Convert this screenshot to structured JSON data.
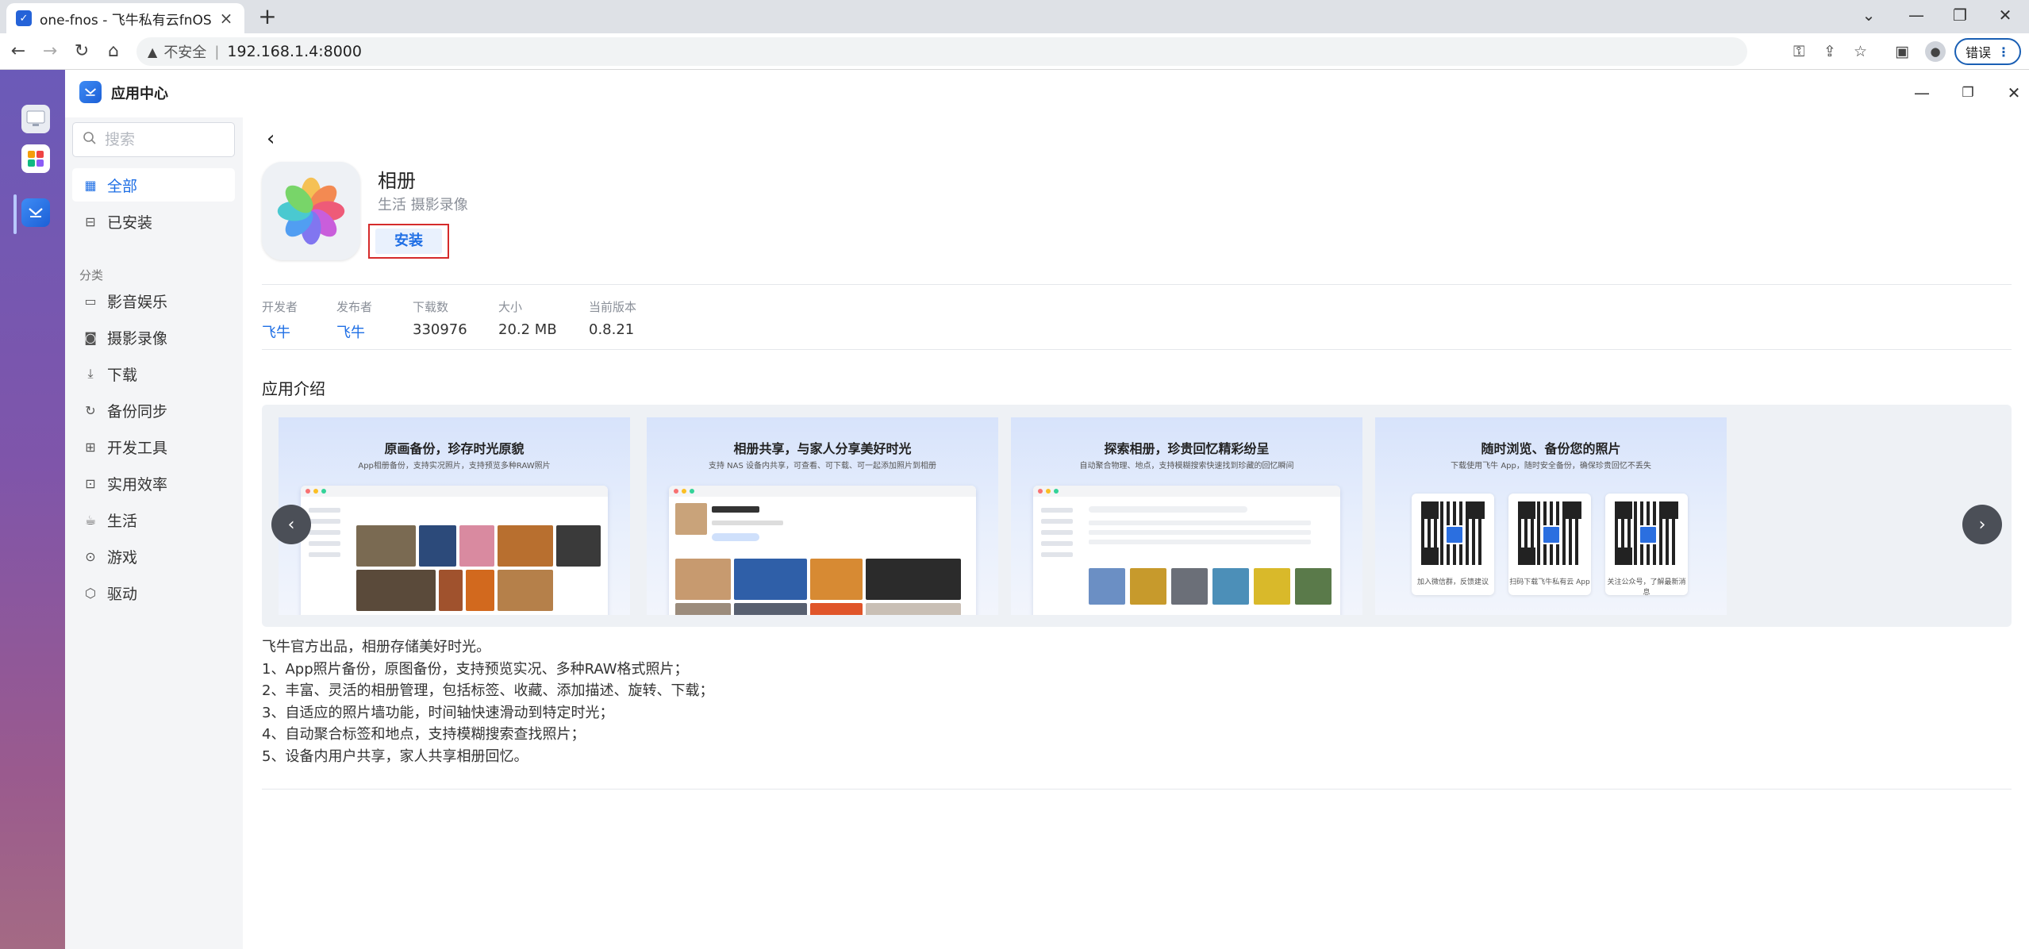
{
  "browser": {
    "tab_title": "one-fnos - 飞牛私有云fnOS",
    "insecure_label": "不安全",
    "url": "192.168.1.4:8000",
    "error_label": "错误"
  },
  "app_window": {
    "title": "应用中心"
  },
  "sidebar": {
    "search_placeholder": "搜索",
    "top_items": [
      {
        "label": "全部",
        "icon": "grid-icon",
        "active": true
      },
      {
        "label": "已安装",
        "icon": "installed-box-icon",
        "active": false
      }
    ],
    "category_heading": "分类",
    "categories": [
      {
        "label": "影音娱乐",
        "icon": "video-icon"
      },
      {
        "label": "摄影录像",
        "icon": "camera-icon"
      },
      {
        "label": "下载",
        "icon": "download-icon"
      },
      {
        "label": "备份同步",
        "icon": "sync-icon"
      },
      {
        "label": "开发工具",
        "icon": "devtools-icon"
      },
      {
        "label": "实用效率",
        "icon": "toolbox-icon"
      },
      {
        "label": "生活",
        "icon": "life-icon"
      },
      {
        "label": "游戏",
        "icon": "gamepad-icon"
      },
      {
        "label": "驱动",
        "icon": "driver-cube-icon"
      }
    ]
  },
  "app_detail": {
    "name": "相册",
    "categories": "生活 摄影录像",
    "install_label": "安装",
    "meta": [
      {
        "key": "开发者",
        "value": "飞牛",
        "link": true
      },
      {
        "key": "发布者",
        "value": "飞牛",
        "link": true
      },
      {
        "key": "下载数",
        "value": "330976",
        "link": false
      },
      {
        "key": "大小",
        "value": "20.2 MB",
        "link": false
      },
      {
        "key": "当前版本",
        "value": "0.8.21",
        "link": false
      }
    ],
    "intro_heading": "应用介绍",
    "screenshots": [
      {
        "title": "原画备份，珍存时光原貌",
        "subtitle": "App相册备份，支持实况照片，支持预览多种RAW照片"
      },
      {
        "title": "相册共享，与家人分享美好时光",
        "subtitle": "支持 NAS 设备内共享，可查看、可下载、可一起添加照片到相册"
      },
      {
        "title": "探索相册，珍贵回忆精彩纷呈",
        "subtitle": "自动聚合物理、地点，支持模糊搜索快速找到珍藏的回忆瞬间"
      },
      {
        "title": "随时浏览、备份您的照片",
        "subtitle": "下载使用飞牛 App，随时安全备份，确保珍贵回忆不丢失",
        "qr_captions": [
          "加入微信群，反馈建议",
          "扫码下载飞牛私有云 App",
          "关注公众号，了解最新消息"
        ]
      }
    ],
    "description": [
      "飞牛官方出品，相册存储美好时光。",
      "1、App照片备份，原图备份，支持预览实况、多种RAW格式照片；",
      "2、丰富、灵活的相册管理，包括标签、收藏、添加描述、旋转、下载；",
      "3、自适应的照片墙功能，时间轴快速滑动到特定时光；",
      "4、自动聚合标签和地点，支持模糊搜索查找照片；",
      "5、设备内用户共享，家人共享相册回忆。"
    ]
  },
  "colors": {
    "accent": "#1f6fe5",
    "highlight_border": "#d52b2b",
    "dock_top": "#6b5ab8",
    "dock_bottom": "#a46a84"
  }
}
